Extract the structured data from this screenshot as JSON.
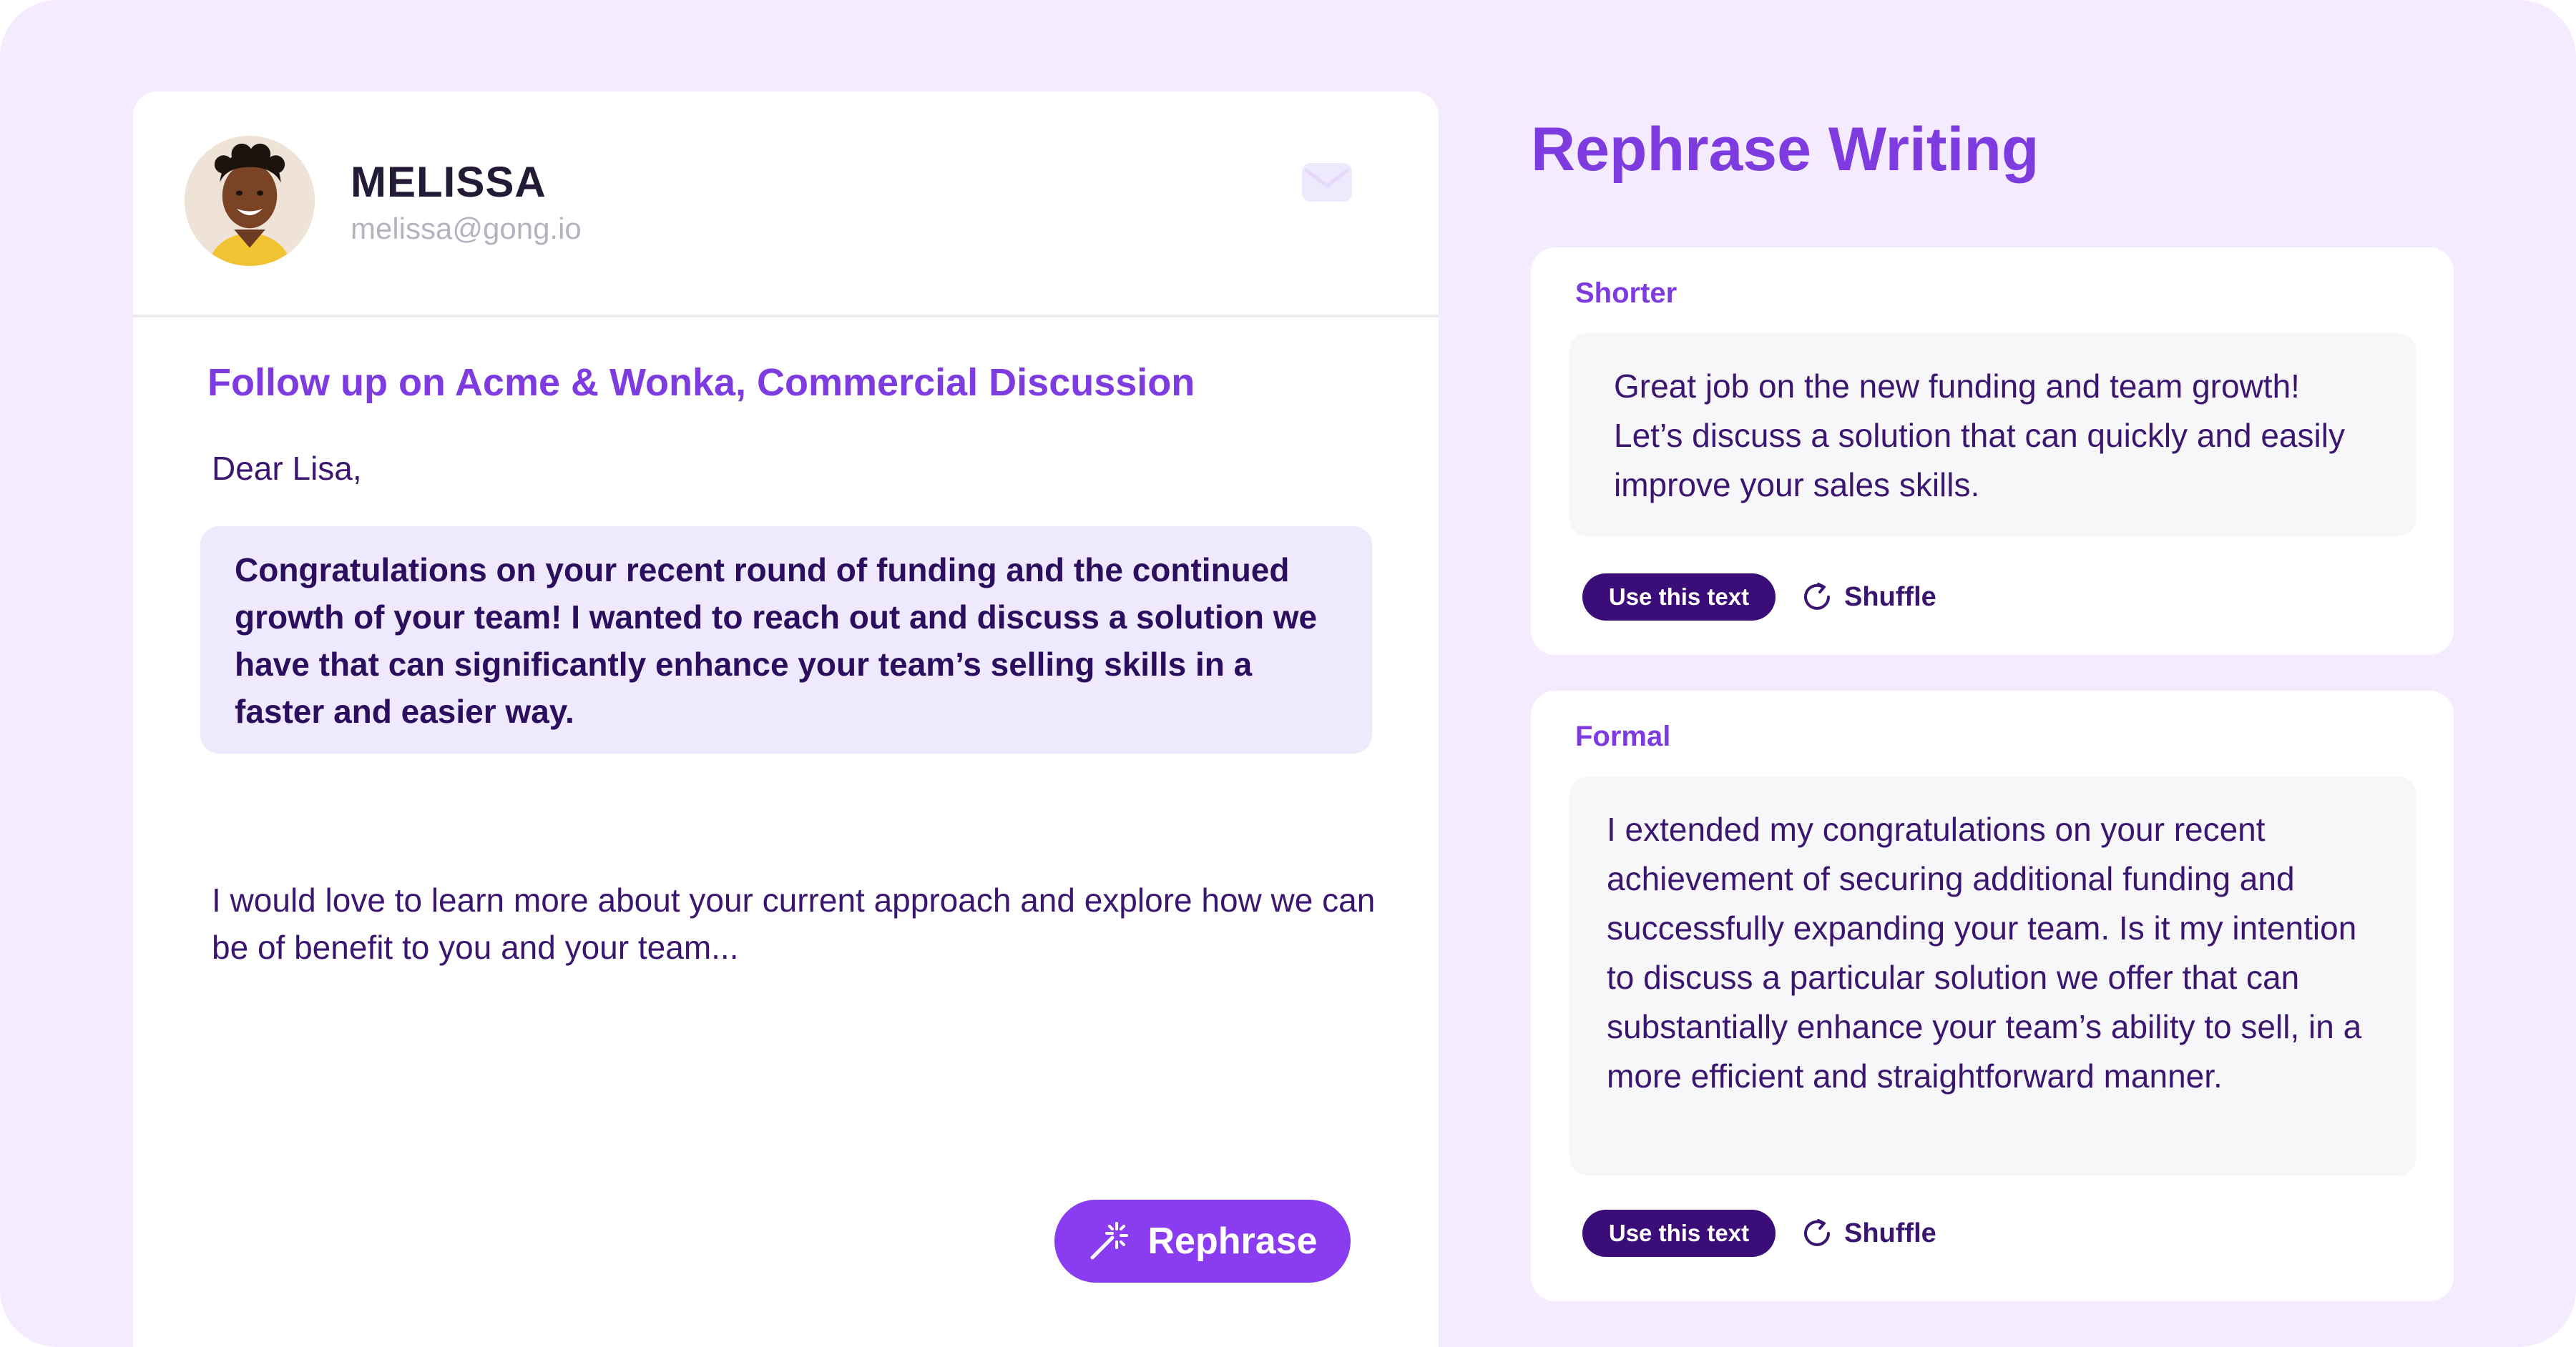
{
  "email": {
    "sender_name": "MELISSA",
    "sender_email": "melissa@gong.io",
    "subject": "Follow up on Acme & Wonka, Commercial Discussion",
    "greeting": "Dear Lisa,",
    "highlighted_text": "Congratulations on your recent round of funding and the continued growth of your team! I wanted to reach out and discuss a solution we have that can significantly enhance your team’s selling skills in a faster and easier way.",
    "body_text": "I would love to learn more about your current approach and explore how we can be of benefit to you and your team...",
    "rephrase_label": "Rephrase",
    "icons": [
      "avatar",
      "mail-icon",
      "magic-wand-icon"
    ]
  },
  "panel": {
    "title": "Rephrase Writing",
    "options": [
      {
        "label": "Shorter",
        "text": "Great job on the new funding and team growth! Let’s discuss a solution that can quickly and easily improve your sales skills.",
        "use_label": "Use this text",
        "shuffle_label": "Shuffle"
      },
      {
        "label": "Formal",
        "text": "I extended my congratulations on your recent achievement of securing additional funding and successfully expanding your team. Is it my intention to discuss a particular solution we offer that can substantially enhance your team’s ability to sell, in a more efficient and straightforward manner.",
        "use_label": "Use this text",
        "shuffle_label": "Shuffle"
      }
    ]
  },
  "colors": {
    "page_background": "#f4ebfe",
    "accent_purple": "#7d3be0",
    "button_purple": "#8a3df0",
    "dark_purple": "#3b0d78",
    "text_purple": "#3b1670",
    "highlight_background": "#efe9fd"
  }
}
